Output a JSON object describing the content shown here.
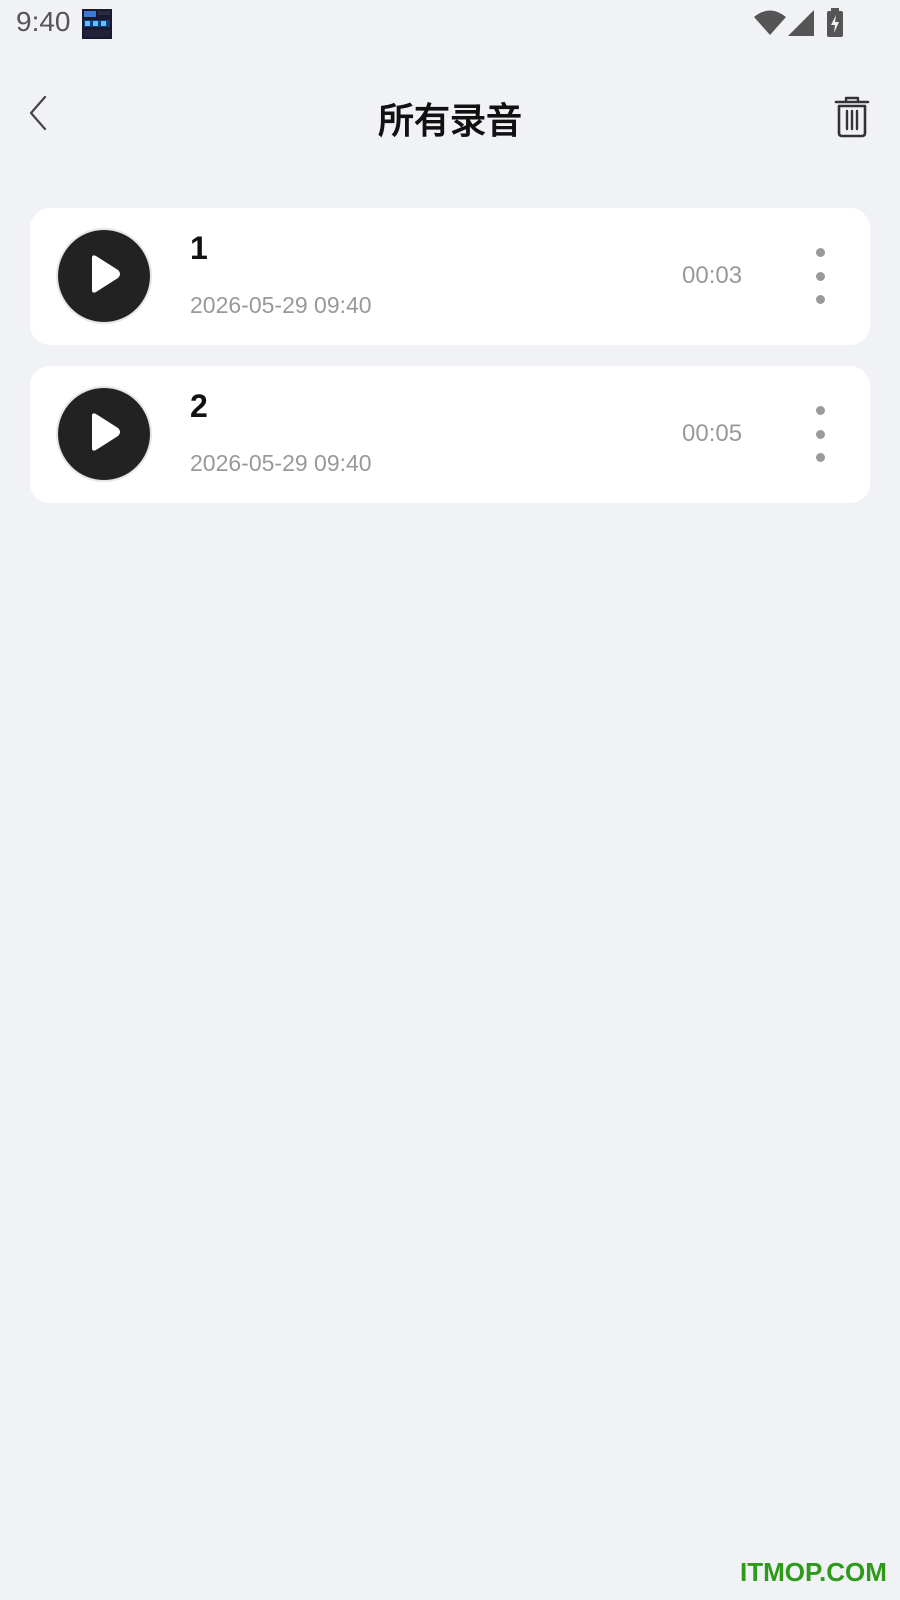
{
  "status_bar": {
    "time": "9:40",
    "icons": [
      "notification-app-icon",
      "wifi-icon",
      "signal-icon",
      "battery-charging-icon"
    ]
  },
  "header": {
    "title": "所有录音",
    "back_icon": "chevron-left-icon",
    "trash_icon": "trash-icon"
  },
  "recordings": [
    {
      "name": "1",
      "date": "2026-05-29 09:40",
      "duration": "00:03"
    },
    {
      "name": "2",
      "date": "2026-05-29 09:40",
      "duration": "00:05"
    }
  ],
  "watermark": "ITMOP.COM",
  "colors": {
    "background": "#f0f2f6",
    "card": "#ffffff",
    "play_button": "#222222",
    "muted_text": "#999999",
    "watermark": "#2d9a18"
  }
}
